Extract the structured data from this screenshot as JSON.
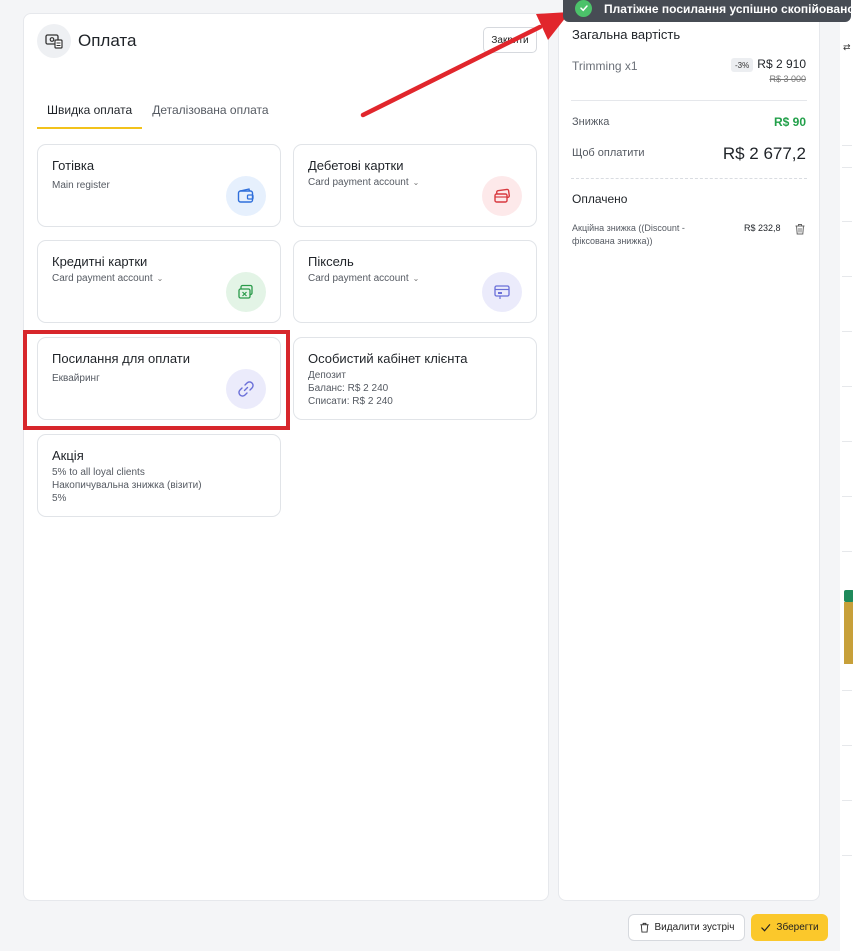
{
  "header": {
    "title": "Оплата",
    "close_label": "Закрити"
  },
  "tabs": [
    {
      "label": "Швидка оплата",
      "active": true
    },
    {
      "label": "Деталізована оплата",
      "active": false
    }
  ],
  "payment_methods": {
    "cash": {
      "title": "Готівка",
      "sub": "Main register",
      "icon": "wallet-icon"
    },
    "debit": {
      "title": "Дебетові картки",
      "sub": "Card payment account",
      "icon": "cards-icon"
    },
    "credit": {
      "title": "Кредитні картки",
      "sub": "Card payment account",
      "icon": "cash-note-icon"
    },
    "pixel": {
      "title": "Піксель",
      "sub": "Card payment account",
      "icon": "screen-card-icon"
    },
    "payment_link": {
      "title": "Посилання для оплати",
      "sub": "Еквайринг",
      "icon": "link-icon"
    },
    "client_cabinet": {
      "title": "Особистий кабінет клієнта",
      "lines": [
        "Депозит",
        "Баланс: R$ 2 240",
        "Списати: R$ 2 240"
      ]
    },
    "promo": {
      "title": "Акція",
      "lines": [
        "5% to all loyal clients",
        "Накопичувальна знижка (візити)",
        "5%"
      ]
    }
  },
  "summary": {
    "title": "Загальна вартість",
    "item_name": "Trimming  x1",
    "item_discount": "-3%",
    "item_price": "R$ 2 910",
    "item_old_price": "R$ 3 000",
    "discount_label": "Знижка",
    "discount_value": "R$ 90",
    "to_pay_label": "Щоб оплатити",
    "to_pay_value": "R$ 2 677,2",
    "paid_title": "Оплачено",
    "paid_item_name": "Акційна знижка ((Discount - фіксована знижка))",
    "paid_item_amount": "R$ 232,8"
  },
  "toast": {
    "text": "Платіжне посилання успішно скопійовано"
  },
  "footer": {
    "delete_label": "Видалити зустріч",
    "save_label": "Зберегти"
  },
  "colors": {
    "accent_yellow": "#fbc82b",
    "discount_green": "#22a04a",
    "highlight_red": "#d7262b",
    "toast_bg": "#474c54"
  }
}
